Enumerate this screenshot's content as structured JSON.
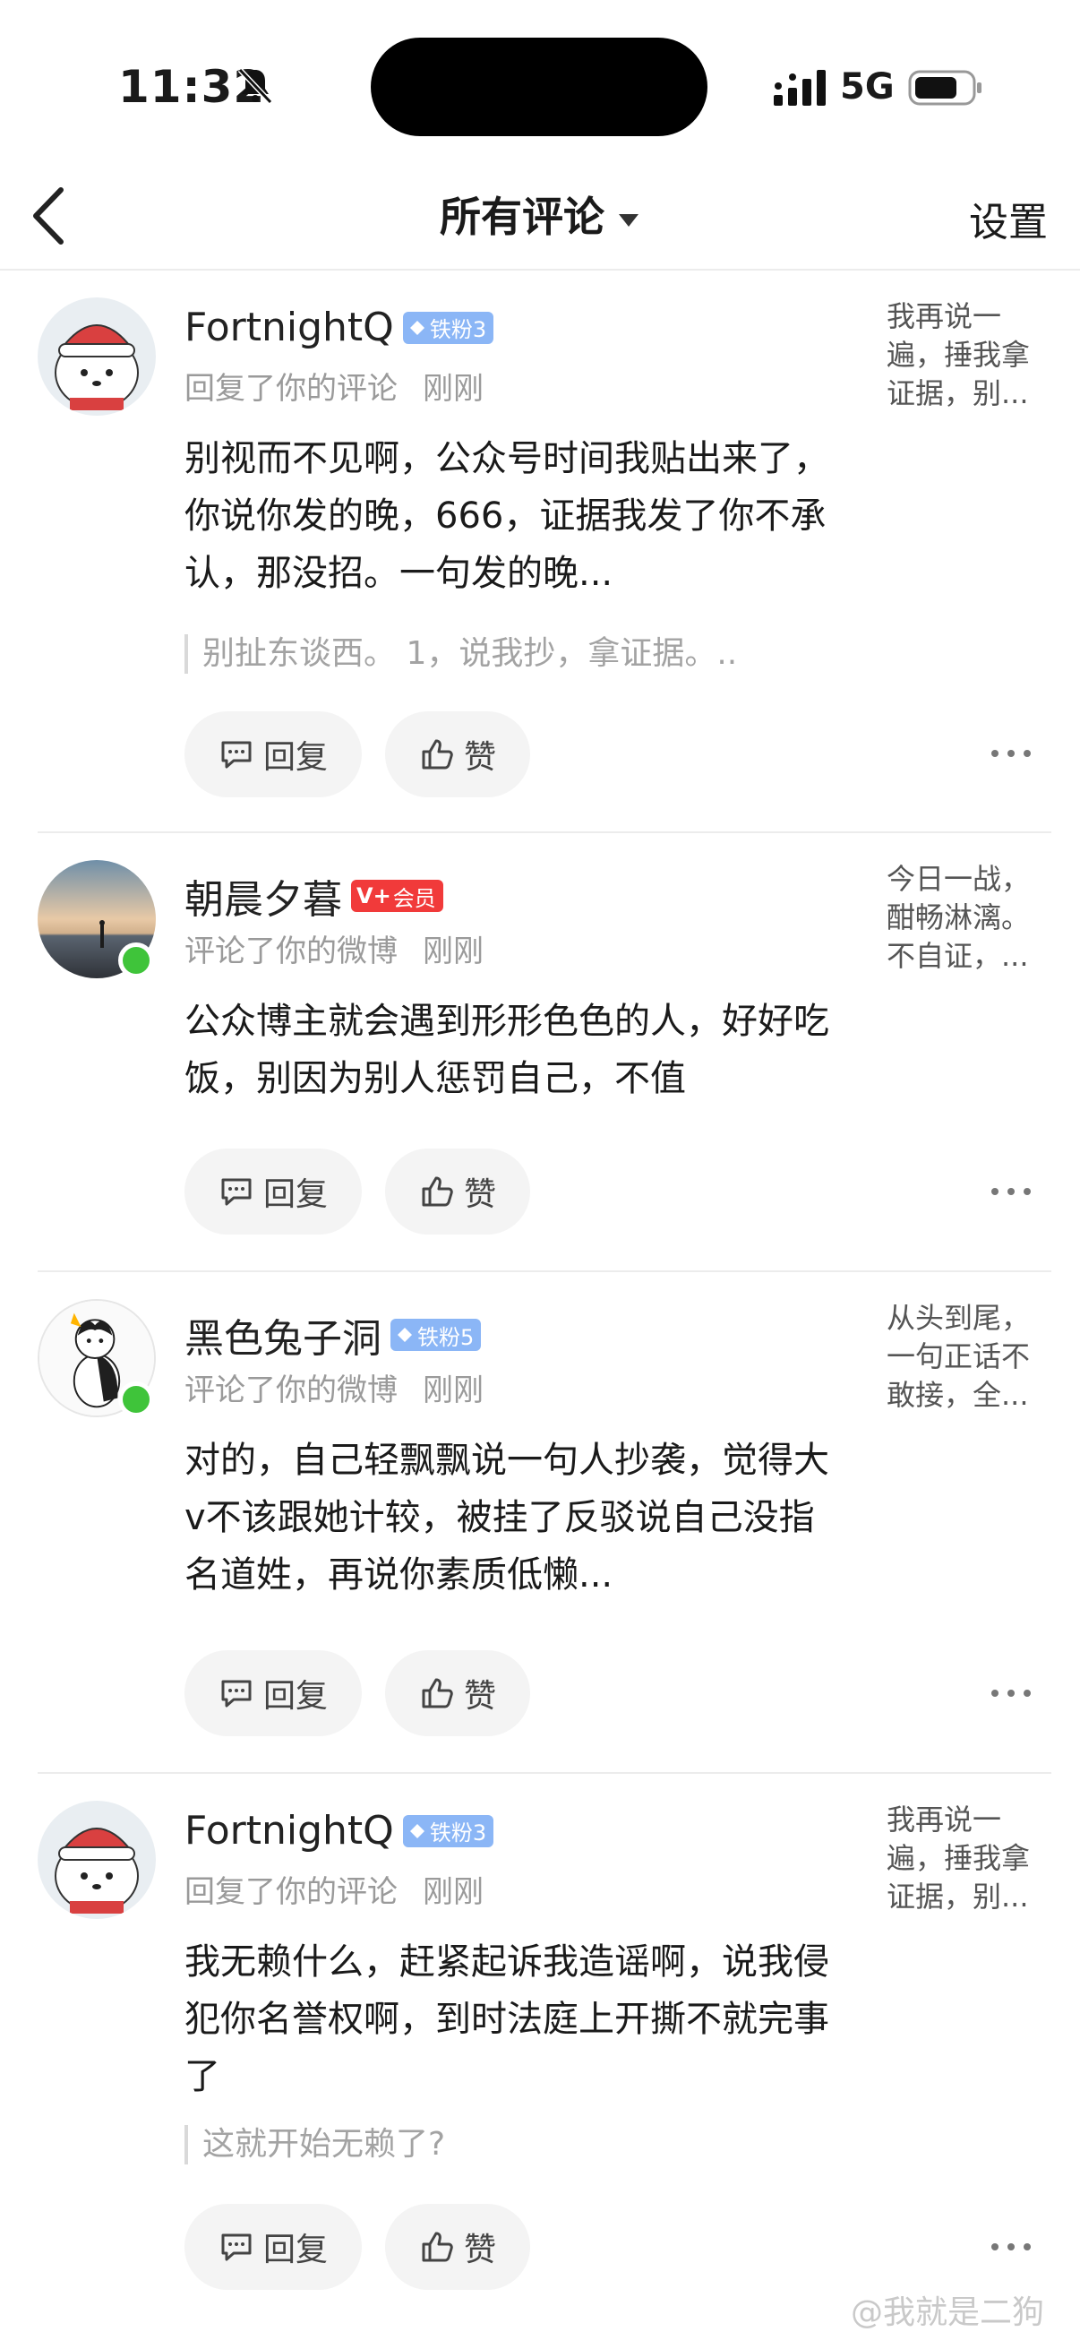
{
  "status_bar": {
    "time": "11:32",
    "network": "5G"
  },
  "nav": {
    "title": "所有评论",
    "settings_label": "设置"
  },
  "labels": {
    "reply": "回复",
    "like": "赞"
  },
  "comments": [
    {
      "user": "FortnightQ",
      "badge": "铁粉3",
      "badge_type": "fan",
      "action": "回复了你的评论",
      "time": "刚刚",
      "text": "别视而不见啊，公众号时间我贴出来了，你说你发的晚，666，证据我发了你不承认，那没招。一句发的晚...",
      "quote": "别扯东谈西。 1，说我抄，拿证据。..",
      "preview": "我再说一遍，捶我拿证据，别..."
    },
    {
      "user": "朝晨夕暮",
      "badge": "会员",
      "badge_type": "vip",
      "action": "评论了你的微博",
      "time": "刚刚",
      "text": "公众博主就会遇到形形色色的人，好好吃饭，别因为别人惩罚自己，不值",
      "quote": "",
      "preview": "今日一战，酣畅淋漓。不自证，..."
    },
    {
      "user": "黑色兔子洞",
      "badge": "铁粉5",
      "badge_type": "fan",
      "action": "评论了你的微博",
      "time": "刚刚",
      "text": "对的，自己轻飘飘说一句人抄袭，觉得大v不该跟她计较，被挂了反驳说自己没指名道姓，再说你素质低懒...",
      "quote": "",
      "preview": "从头到尾，一句正话不敢接，全..."
    },
    {
      "user": "FortnightQ",
      "badge": "铁粉3",
      "badge_type": "fan",
      "action": "回复了你的评论",
      "time": "刚刚",
      "text": "我无赖什么，赶紧起诉我造谣啊，说我侵犯你名誉权啊，到时法庭上开撕不就完事了",
      "quote": "这就开始无赖了?",
      "preview": "我再说一遍，捶我拿证据，别..."
    }
  ],
  "watermark": "@我就是二狗",
  "colors": {
    "fan_badge": "#8bb6f6",
    "vip_badge": "#f13a3a",
    "online": "#3fc43a"
  }
}
